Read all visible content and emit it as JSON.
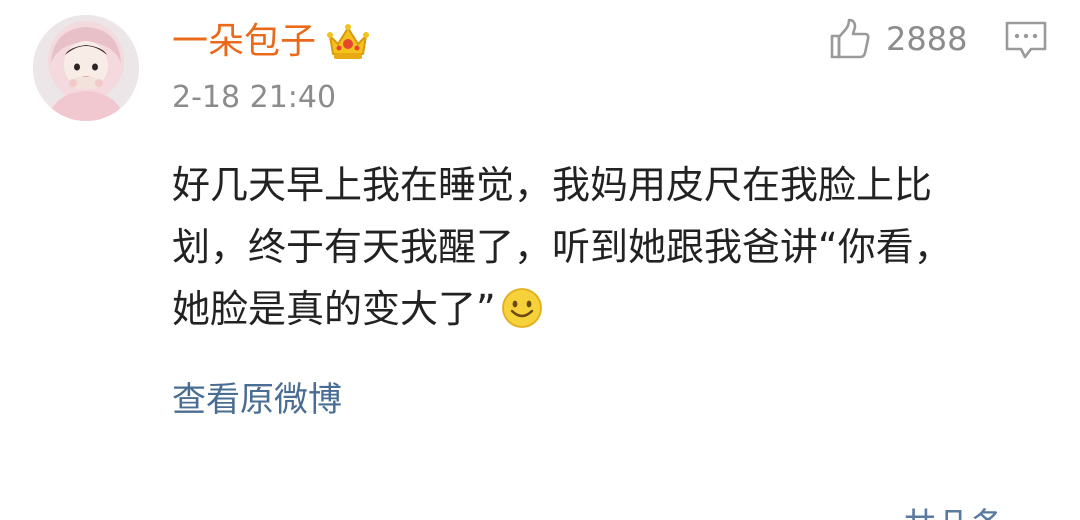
{
  "comment": {
    "username": "一朵包子",
    "badge_icon": "crown-icon",
    "timestamp": "2-18 21:40",
    "like_icon": "thumbs-up-icon",
    "like_count": "2888",
    "reply_icon": "comment-bubble-icon",
    "content_lines": [
      "好几天早上我在睡觉，我妈用皮尺在我脸上比",
      "划，终于有天我醒了，听到她跟我爸讲“你看，",
      "她脸是真的变大了”"
    ],
    "emoji_icon": "smile-emoji-icon",
    "view_original_label": "查看原微博",
    "partial_reply_label": "— 共几条"
  },
  "colors": {
    "username": "#ea6a1b",
    "link": "#4a6d93",
    "meta": "#8c8c8c",
    "text": "#222222"
  }
}
